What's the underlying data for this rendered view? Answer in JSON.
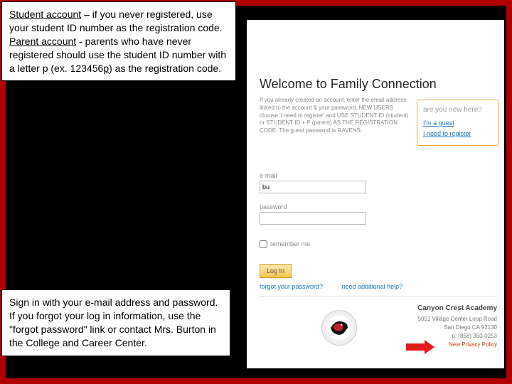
{
  "callout1": {
    "u1": "Student account",
    "t1": " – if you never registered, use your student ID number as the registration code.",
    "u2": "Parent account",
    "t2": " - parents who have never registered should use the student ID number with a letter p (ex. 123456",
    "p": "p",
    "t3": ") as the registration code."
  },
  "callout2": {
    "text": "Sign in with your e-mail address and password.  If you forgot your log in information, use the \"forgot password\" link or contact Mrs. Burton in the College and Career Center."
  },
  "page": {
    "title": "Welcome to Family Connection",
    "intro": "If you already created an account, enter the email address linked to the account & your password. NEW USERS choose 'I need to register' and USE STUDENT ID (student) or STUDENT ID + P (parent) AS THE REGISTRATION CODE. The guest password is RAVENS."
  },
  "newhere": {
    "q": "are you new here?",
    "guest": "I'm a guest",
    "register": "I need to register"
  },
  "form": {
    "email_label": "e-mail",
    "email_value": "bu",
    "password_label": "password",
    "remember": "remember me",
    "login": "Log In"
  },
  "help": {
    "forgot": "forgot your password?",
    "addl": "need additional help?"
  },
  "school": {
    "name": "Canyon Crest Academy",
    "line1": "5051 Village Center Loop Road",
    "line2": "San Diego CA 92130",
    "line3": "p: (858) 350-0253",
    "privacy": "New Privacy Policy"
  }
}
